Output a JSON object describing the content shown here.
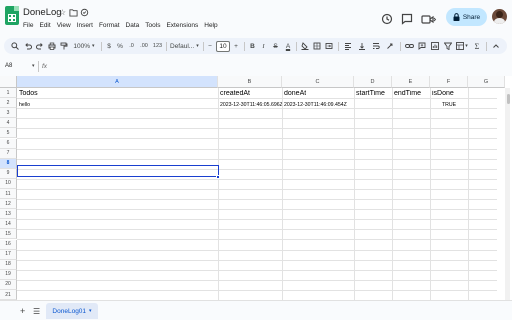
{
  "app": {
    "title": "DoneLog",
    "menu": [
      "File",
      "Edit",
      "View",
      "Insert",
      "Format",
      "Data",
      "Tools",
      "Extensions",
      "Help"
    ],
    "share_label": "Share"
  },
  "toolbar": {
    "zoom": "100%",
    "percent": "%",
    "decimal_dec": ".0",
    "decimal_inc": ".00",
    "number_format": "123",
    "font": "Defaul...",
    "font_size": "10",
    "minus": "−",
    "plus": "+",
    "bold": "B",
    "italic": "I",
    "strike": "S",
    "text_color": "A"
  },
  "formula_bar": {
    "name_box": "A8",
    "fx": "fx"
  },
  "grid": {
    "columns": [
      "A",
      "B",
      "C",
      "D",
      "E",
      "F",
      "G"
    ],
    "rows": [
      "1",
      "2",
      "3",
      "4",
      "5",
      "6",
      "7",
      "8",
      "9",
      "10",
      "11",
      "12",
      "13",
      "14",
      "15",
      "16",
      "17",
      "18",
      "19",
      "20",
      "21"
    ],
    "headers": {
      "a1": "Todos",
      "b1": "createdAt",
      "c1": "doneAt",
      "d1": "startTime",
      "e1": "endTime",
      "f1": "isDone"
    },
    "row2": {
      "a2": "hello",
      "b2": "2023-12-30T11:46:05.696Z",
      "c2": "2023-12-30T11:46:09.454Z",
      "f2": "TRUE"
    },
    "selected_cell": "A8"
  },
  "sheets": {
    "active": "DoneLog01"
  },
  "colors": {
    "accent": "#0b57d0",
    "share_bg": "#c2e7ff",
    "sheets_green": "#1fa463",
    "selection": "#1a3fcf"
  }
}
